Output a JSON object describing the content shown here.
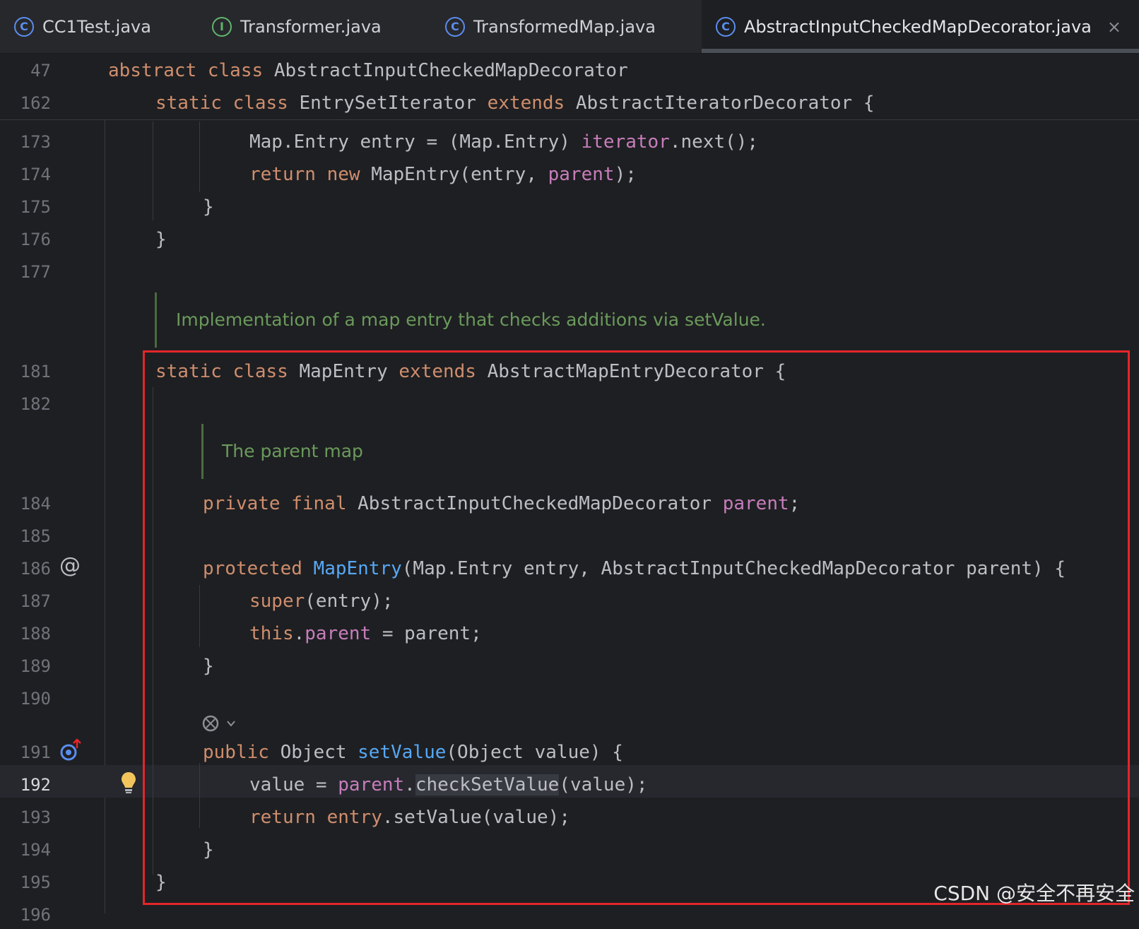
{
  "tabs": [
    {
      "label": "CC1Test.java",
      "icon": "C"
    },
    {
      "label": "Transformer.java",
      "icon": "I"
    },
    {
      "label": "TransformedMap.java",
      "icon": "C"
    },
    {
      "label": "AbstractInputCheckedMapDecorator.java",
      "icon": "C",
      "close": "×"
    }
  ],
  "sticky": {
    "line_a": {
      "num": "47",
      "t1": "abstract class ",
      "t2": "AbstractInputCheckedMapDecorator"
    },
    "line_b": {
      "num": "162",
      "t1": "static class ",
      "t2": "EntrySetIterator ",
      "t3": "extends ",
      "t4": "AbstractIteratorDecorator {"
    }
  },
  "lines": {
    "l173": {
      "num": "173",
      "a": "Map.Entry entry = (Map.Entry) ",
      "b": "iterator",
      "c": ".next();"
    },
    "l174": {
      "num": "174",
      "a": "return new ",
      "b": "MapEntry(entry, ",
      "c": "parent",
      "d": ");"
    },
    "l175": {
      "num": "175",
      "a": "}"
    },
    "l176": {
      "num": "176",
      "a": "}"
    },
    "l177": {
      "num": "177"
    },
    "doc1": "Implementation of a map entry that checks additions via setValue.",
    "l181": {
      "num": "181",
      "a": "static class ",
      "b": "MapEntry ",
      "c": "extends ",
      "d": "AbstractMapEntryDecorator {"
    },
    "l182": {
      "num": "182"
    },
    "doc2": "The parent map",
    "l184": {
      "num": "184",
      "a": "private final ",
      "b": "AbstractInputCheckedMapDecorator ",
      "c": "parent",
      "d": ";"
    },
    "l185": {
      "num": "185"
    },
    "l186": {
      "num": "186",
      "a": "protected ",
      "b": "MapEntry",
      "c": "(Map.Entry entry, AbstractInputCheckedMapDecorator parent) {",
      "icon": "@"
    },
    "l187": {
      "num": "187",
      "a": "super",
      "b": "(entry);"
    },
    "l188": {
      "num": "188",
      "a": "this",
      "b": ".",
      "c": "parent",
      "d": " = parent;"
    },
    "l189": {
      "num": "189",
      "a": "}"
    },
    "l190": {
      "num": "190"
    },
    "l191": {
      "num": "191",
      "a": "public ",
      "b": "Object ",
      "c": "setValue",
      "d": "(Object value) {"
    },
    "l192": {
      "num": "192",
      "a": "value = ",
      "b": "parent",
      "c": ".",
      "d": "checkSetValue",
      "e": "(value);"
    },
    "l193": {
      "num": "193",
      "a": "return ",
      "b": "entry",
      "c": ".setValue(value);"
    },
    "l194": {
      "num": "194",
      "a": "}"
    },
    "l195": {
      "num": "195",
      "a": "}"
    },
    "l196": {
      "num": "196"
    }
  },
  "watermark": "CSDN @安全不再安全",
  "colors": {
    "keyword": "#cf8e6d",
    "plain": "#bcbec4",
    "method": "#56a8f5",
    "field": "#c77dbb",
    "doc": "#6a9a5b",
    "highlight_box": "#e3262b"
  }
}
